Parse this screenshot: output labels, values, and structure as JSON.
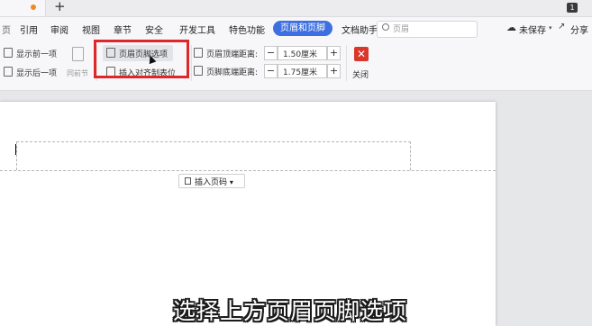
{
  "tabbar": {
    "new_tab": "+",
    "badge": "1"
  },
  "menu": {
    "items": [
      "引用",
      "审阅",
      "视图",
      "章节",
      "安全",
      "开发工具",
      "特色功能"
    ],
    "active": "页眉和页脚",
    "after_active": "文档助手",
    "search_placeholder": "页眉",
    "unsaved": "未保存",
    "share": "分享",
    "partial_left": "页"
  },
  "ribbon": {
    "show_prev": "显示前一项",
    "show_next": "显示后一项",
    "same_as_prev": "同前节",
    "header_footer_options": "页眉页脚选项",
    "insert_align_tab": "插入对齐制表位",
    "header_top_label": "页眉顶端距离:",
    "header_top_value": "1.50厘米",
    "footer_bottom_label": "页脚底端距离:",
    "footer_bottom_value": "1.75厘米",
    "minus": "−",
    "plus": "+",
    "close": "关闭",
    "close_x": "✕"
  },
  "document": {
    "insert_page_number": "插入页码",
    "dropdown_arrow": "▾"
  },
  "subtitle": "选择上方页眉页脚选项",
  "colors": {
    "accent": "#3d6fe0",
    "highlight_box": "#e0262b",
    "close": "#d9362c",
    "tab_dot": "#f08a24"
  }
}
